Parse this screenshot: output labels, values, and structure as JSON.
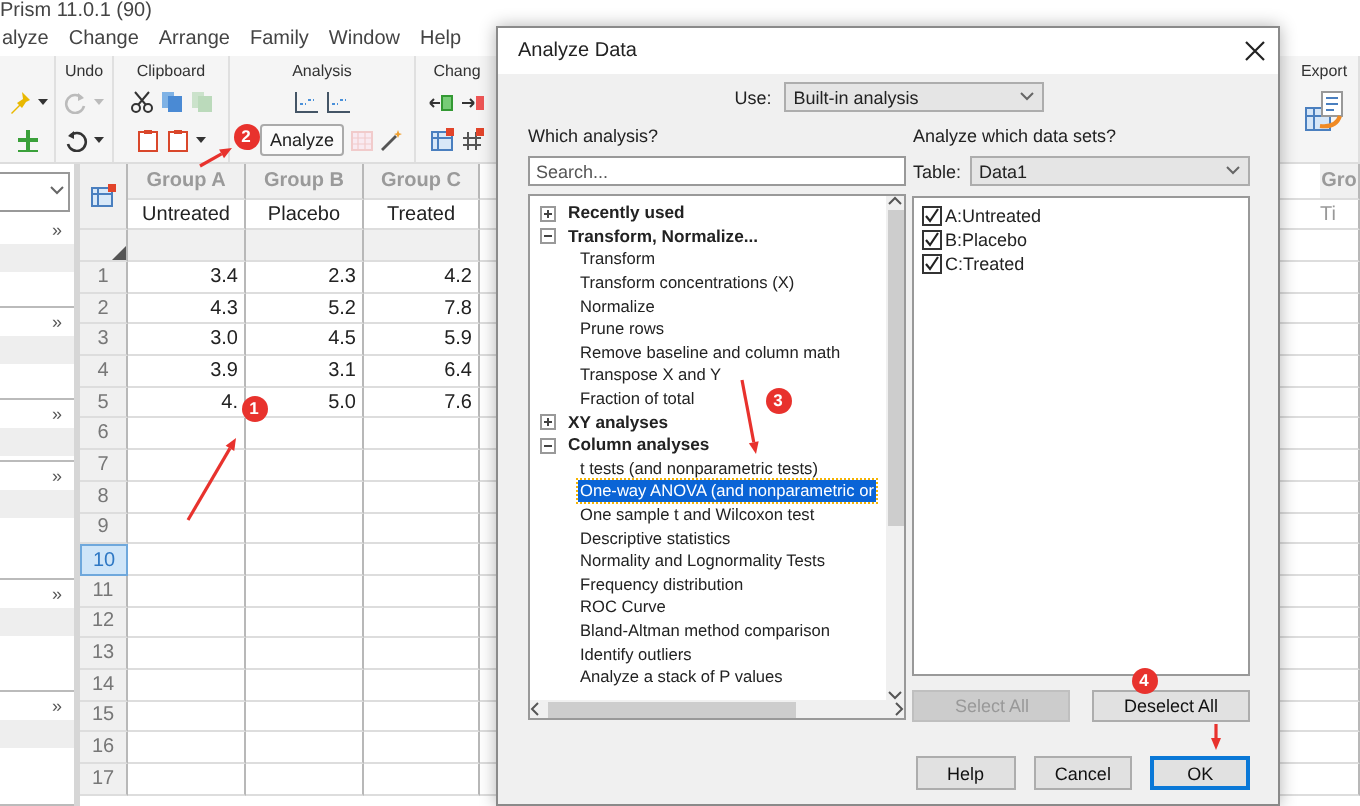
{
  "window": {
    "title": "Prism 11.0.1 (90)"
  },
  "menu": [
    {
      "label": "alyze"
    },
    {
      "label": "Change"
    },
    {
      "label": "Arrange"
    },
    {
      "label": "Family"
    },
    {
      "label": "Window"
    },
    {
      "label": "Help"
    }
  ],
  "ribbon": {
    "undo_label": "Undo",
    "clipboard_label": "Clipboard",
    "analysis_label": "Analysis",
    "change_label": "Chang",
    "export_label": "Export",
    "analyze_button": "Analyze"
  },
  "navigator": {
    "toggles": [
      "»",
      "»",
      "»",
      "»",
      "»",
      "»"
    ]
  },
  "sheet": {
    "columns": [
      {
        "title": "Group A",
        "subtitle": "Untreated"
      },
      {
        "title": "Group B",
        "subtitle": "Placebo"
      },
      {
        "title": "Group C",
        "subtitle": "Treated"
      }
    ],
    "partial_column": {
      "title": "Gro",
      "subtitle": "Ti"
    },
    "rows": [
      {
        "number": "1",
        "values": [
          "3.4",
          "2.3",
          "4.2"
        ],
        "selected": false
      },
      {
        "number": "2",
        "values": [
          "4.3",
          "5.2",
          "7.8"
        ],
        "selected": false
      },
      {
        "number": "3",
        "values": [
          "3.0",
          "4.5",
          "5.9"
        ],
        "selected": false
      },
      {
        "number": "4",
        "values": [
          "3.9",
          "3.1",
          "6.4"
        ],
        "selected": false
      },
      {
        "number": "5",
        "values": [
          "4.",
          "5.0",
          "7.6"
        ],
        "selected": false
      },
      {
        "number": "6",
        "selected": false
      },
      {
        "number": "7",
        "selected": false
      },
      {
        "number": "8",
        "selected": false
      },
      {
        "number": "9",
        "selected": false
      },
      {
        "number": "10",
        "selected": true
      },
      {
        "number": "11",
        "selected": false
      },
      {
        "number": "12",
        "selected": false
      },
      {
        "number": "13",
        "selected": false
      },
      {
        "number": "14",
        "selected": false
      },
      {
        "number": "15",
        "selected": false
      },
      {
        "number": "16",
        "selected": false
      },
      {
        "number": "17",
        "selected": false
      }
    ]
  },
  "dialog": {
    "title": "Analyze Data",
    "use_label": "Use:",
    "use_value": "Built-in analysis",
    "which_label": "Which analysis?",
    "search": {
      "placeholder": "Search..."
    },
    "tree": [
      {
        "label": "Recently used",
        "expanded": false,
        "selected": false
      },
      {
        "label": "Transform, Normalize...",
        "expanded": true,
        "selected": false,
        "children": [
          {
            "label": "Transform",
            "selected": false
          },
          {
            "label": "Transform concentrations (X)",
            "selected": false
          },
          {
            "label": "Normalize",
            "selected": false
          },
          {
            "label": "Prune rows",
            "selected": false
          },
          {
            "label": "Remove baseline and column math",
            "selected": false
          },
          {
            "label": "Transpose X and Y",
            "selected": false
          },
          {
            "label": "Fraction of total",
            "selected": false
          }
        ]
      },
      {
        "label": "XY analyses",
        "expanded": false,
        "selected": false
      },
      {
        "label": "Column analyses",
        "expanded": true,
        "selected": false,
        "children": [
          {
            "label": "t tests (and nonparametric tests)",
            "selected": false
          },
          {
            "label": "One-way ANOVA (and nonparametric or",
            "selected": true
          },
          {
            "label": "One sample t and Wilcoxon test",
            "selected": false
          },
          {
            "label": "Descriptive statistics",
            "selected": false
          },
          {
            "label": "Normality and Lognormality Tests",
            "selected": false
          },
          {
            "label": "Frequency distribution",
            "selected": false
          },
          {
            "label": "ROC Curve",
            "selected": false
          },
          {
            "label": "Bland-Altman method comparison",
            "selected": false
          },
          {
            "label": "Identify outliers",
            "selected": false
          },
          {
            "label": "Analyze a stack of P values",
            "selected": false
          }
        ]
      }
    ],
    "datasets_label": "Analyze which data sets?",
    "table_label": "Table:",
    "table_value": "Data1",
    "datasets": [
      {
        "label": "A:Untreated",
        "checked": true
      },
      {
        "label": "B:Placebo",
        "checked": true
      },
      {
        "label": "C:Treated",
        "checked": true
      }
    ],
    "select_all": {
      "label": "Select All",
      "disabled": true
    },
    "deselect_all": {
      "label": "Deselect All",
      "disabled": false
    },
    "buttons": [
      {
        "label": "Help",
        "default": false
      },
      {
        "label": "Cancel",
        "default": false
      },
      {
        "label": "OK",
        "default": true
      }
    ]
  },
  "annotations": [
    {
      "number": "1"
    },
    {
      "number": "2"
    },
    {
      "number": "3"
    },
    {
      "number": "4"
    }
  ]
}
